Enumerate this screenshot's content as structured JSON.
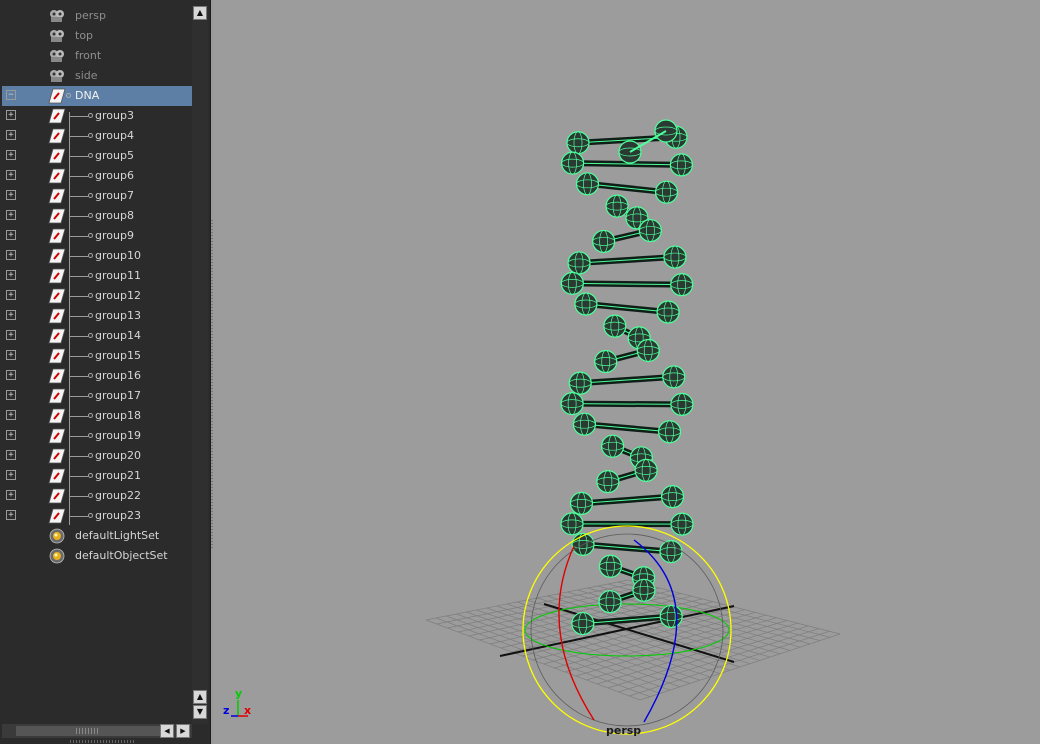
{
  "outliner": {
    "cameras": [
      {
        "label": "persp"
      },
      {
        "label": "top"
      },
      {
        "label": "front"
      },
      {
        "label": "side"
      }
    ],
    "root": {
      "label": "DNA",
      "expander": "−"
    },
    "groups": [
      {
        "label": "group3"
      },
      {
        "label": "group4"
      },
      {
        "label": "group5"
      },
      {
        "label": "group6"
      },
      {
        "label": "group7"
      },
      {
        "label": "group8"
      },
      {
        "label": "group9"
      },
      {
        "label": "group10"
      },
      {
        "label": "group11"
      },
      {
        "label": "group12"
      },
      {
        "label": "group13"
      },
      {
        "label": "group14"
      },
      {
        "label": "group15"
      },
      {
        "label": "group16"
      },
      {
        "label": "group17"
      },
      {
        "label": "group18"
      },
      {
        "label": "group19"
      },
      {
        "label": "group20"
      },
      {
        "label": "group21"
      },
      {
        "label": "group22"
      },
      {
        "label": "group23"
      }
    ],
    "sets": [
      {
        "label": "defaultLightSet"
      },
      {
        "label": "defaultObjectSet"
      }
    ],
    "group_expander": "+",
    "scroll_up": "▲",
    "scroll_down": "▼",
    "scroll_left": "◀",
    "scroll_right": "▶"
  },
  "viewport": {
    "camera_label": "persp",
    "axis": {
      "x": "x",
      "y": "y",
      "z": "z"
    },
    "colors": {
      "background": "#9c9c9c",
      "wireframe": "#4dff9a",
      "sphere": "#2a3a33",
      "manip_outer": "#ffff00",
      "manip_x": "#e00000",
      "manip_y": "#00cc00",
      "manip_z": "#0000e0",
      "grid": "#7e7e7e"
    }
  }
}
